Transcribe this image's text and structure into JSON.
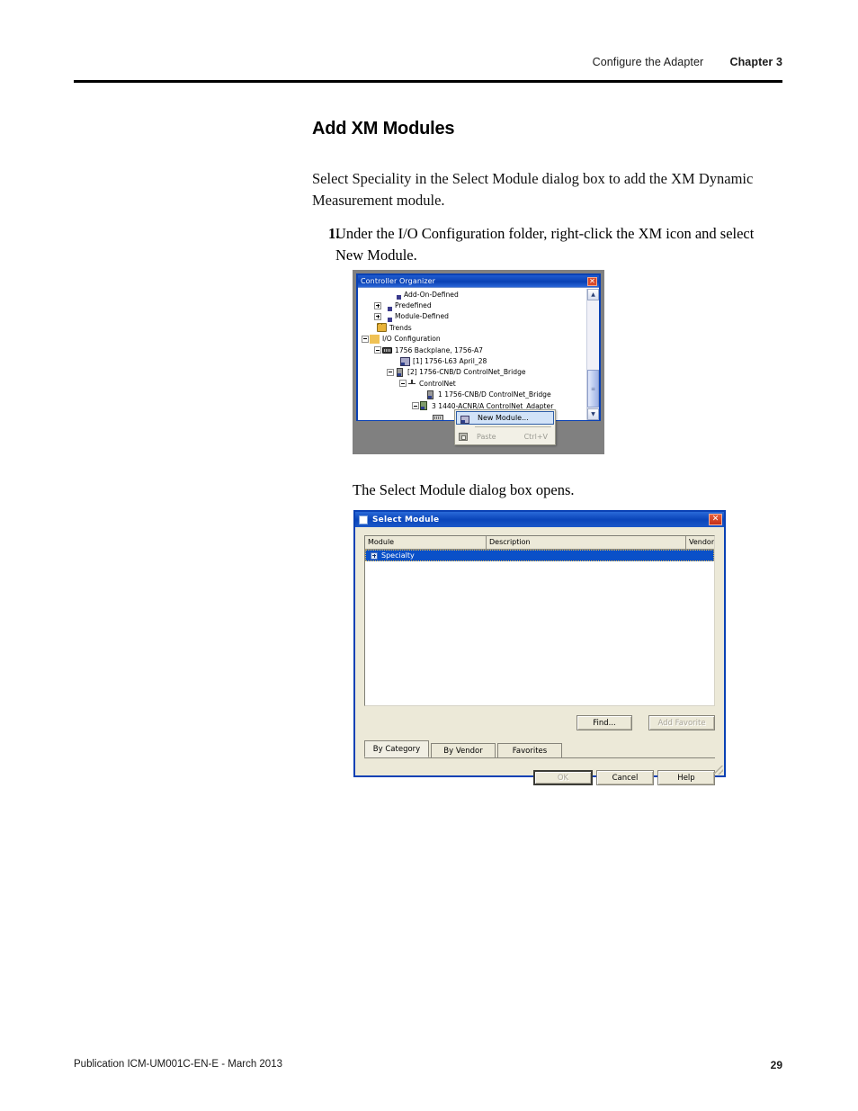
{
  "header": {
    "running_head": "Configure the Adapter",
    "chapter": "Chapter 3"
  },
  "section": {
    "title": "Add XM Modules",
    "intro": "Select Speciality in the Select Module dialog box to add the XM Dynamic Measurement module.",
    "steps": [
      {
        "number": "1.",
        "text": "Under the I/O Configuration folder, right-click the XM icon and select New Module."
      }
    ],
    "after_figure_text": "The Select Module dialog box opens."
  },
  "controller_organizer": {
    "title": "Controller Organizer",
    "close_label": "✕",
    "tree": [
      {
        "label": "Add-On-Defined",
        "indent": 28,
        "expander": "none",
        "icon": "folder-xm"
      },
      {
        "label": "Predefined",
        "indent": 18,
        "expander": "plus",
        "icon": "folder-xm"
      },
      {
        "label": "Module-Defined",
        "indent": 18,
        "expander": "plus",
        "icon": "folder-xm"
      },
      {
        "label": "Trends",
        "indent": 12,
        "expander": "none",
        "icon": "folder"
      },
      {
        "label": "I/O Configuration",
        "indent": 4,
        "expander": "minus",
        "icon": "folder-open"
      },
      {
        "label": "1756 Backplane, 1756-A7",
        "indent": 18,
        "expander": "minus",
        "icon": "chassis"
      },
      {
        "label": "[1] 1756-L63 April_28",
        "indent": 38,
        "expander": "none",
        "icon": "controller"
      },
      {
        "label": "[2] 1756-CNB/D ControlNet_Bridge",
        "indent": 32,
        "expander": "minus",
        "icon": "module"
      },
      {
        "label": "ControlNet",
        "indent": 46,
        "expander": "minus",
        "icon": "net"
      },
      {
        "label": "1 1756-CNB/D ControlNet_Bridge",
        "indent": 66,
        "expander": "none",
        "icon": "module"
      },
      {
        "label": "3 1440-ACNR/A ControlNet_Adapter",
        "indent": 60,
        "expander": "minus",
        "icon": "adapter"
      },
      {
        "label": "",
        "indent": 74,
        "expander": "none",
        "icon": "xm"
      }
    ],
    "scrollbar": {
      "up_arrow": "▲",
      "down_arrow": "▼",
      "thumb_grip": "≡"
    },
    "context_menu": {
      "items": [
        {
          "label": "New Module...",
          "accel": "",
          "state": "selected",
          "icon": "new-module-icon"
        },
        {
          "label": "Paste",
          "accel": "Ctrl+V",
          "state": "disabled",
          "icon": "paste-icon"
        }
      ]
    }
  },
  "select_module_dialog": {
    "title": "Select Module",
    "close_label": "✕",
    "columns": [
      "Module",
      "Description",
      "Vendor"
    ],
    "rows": [
      {
        "module": "Specialty",
        "description": "",
        "vendor": "",
        "selected": true,
        "expandable": true
      }
    ],
    "buttons": {
      "find": "Find...",
      "add_favorite": "Add Favorite",
      "ok": "OK",
      "cancel": "Cancel",
      "help": "Help"
    },
    "tabs": [
      {
        "label": "By Category",
        "active": true
      },
      {
        "label": "By Vendor",
        "active": false
      },
      {
        "label": "Favorites",
        "active": false
      }
    ]
  },
  "footer": {
    "publication": "Publication ICM-UM001C-EN-E - March 2013",
    "page_number": "29"
  }
}
